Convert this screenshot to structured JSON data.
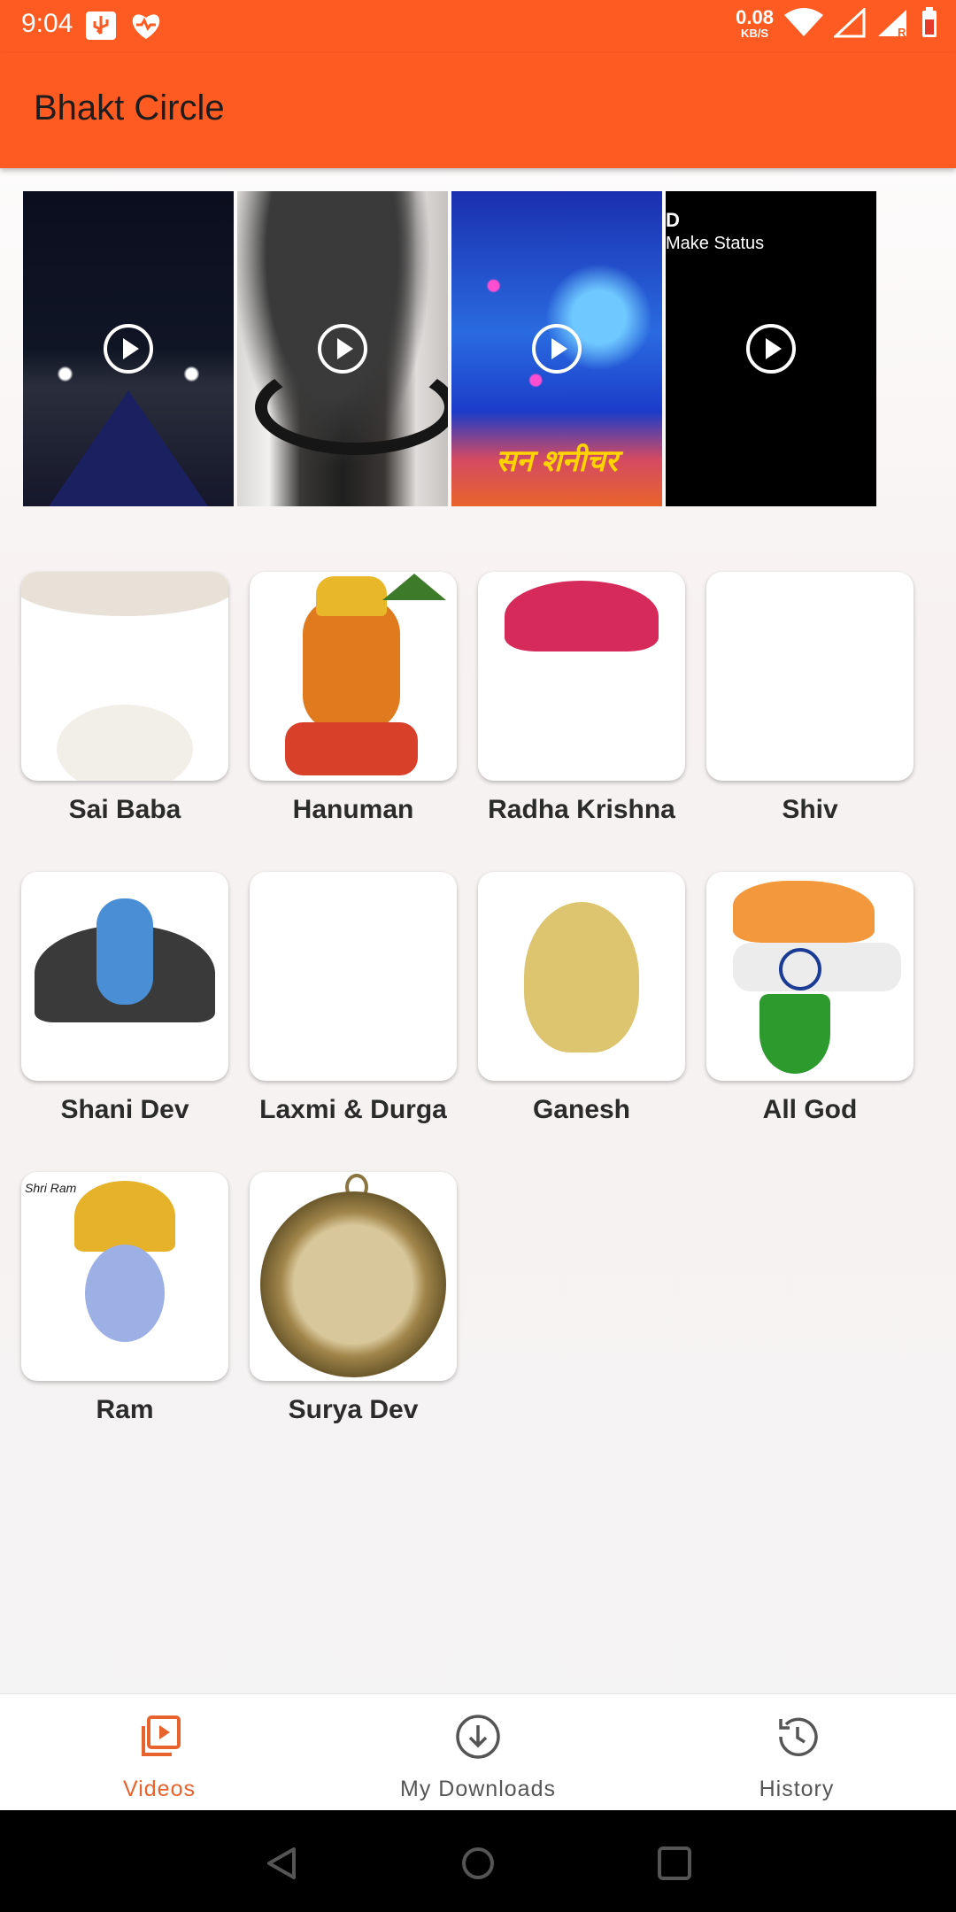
{
  "status_bar": {
    "time": "9:04",
    "net_speed_value": "0.08",
    "net_speed_unit": "KB/S",
    "icons_left": [
      "usb-icon",
      "heart-app-icon"
    ],
    "icons_right": [
      "wifi-icon",
      "signal-icon",
      "signal-roaming-icon",
      "battery-icon"
    ]
  },
  "app_bar": {
    "title": "Bhakt Circle",
    "color": "#fe5b22"
  },
  "videos": [
    {
      "name": "video-1",
      "text": ""
    },
    {
      "name": "video-2",
      "text": ""
    },
    {
      "name": "video-3",
      "text": "सन शनीचर"
    },
    {
      "name": "video-4",
      "text": "Make Status",
      "corner_text": "D"
    }
  ],
  "categories": [
    {
      "label": "Sai Baba"
    },
    {
      "label": "Hanuman"
    },
    {
      "label": "Radha Krishna"
    },
    {
      "label": "Shiv"
    },
    {
      "label": "Shani Dev"
    },
    {
      "label": "Laxmi & Durga"
    },
    {
      "label": "Ganesh"
    },
    {
      "label": "All God"
    },
    {
      "label": "Ram",
      "thumb_text": "Shri Ram"
    },
    {
      "label": "Surya Dev"
    }
  ],
  "bottom_nav": {
    "active_color": "#e8622d",
    "inactive_color": "#555555",
    "items": [
      {
        "label": "Videos",
        "icon": "video-library-icon",
        "active": true
      },
      {
        "label": "My Downloads",
        "icon": "download-icon",
        "active": false
      },
      {
        "label": "History",
        "icon": "history-icon",
        "active": false
      }
    ]
  },
  "system_nav": [
    "back-icon",
    "home-icon",
    "recents-icon"
  ]
}
